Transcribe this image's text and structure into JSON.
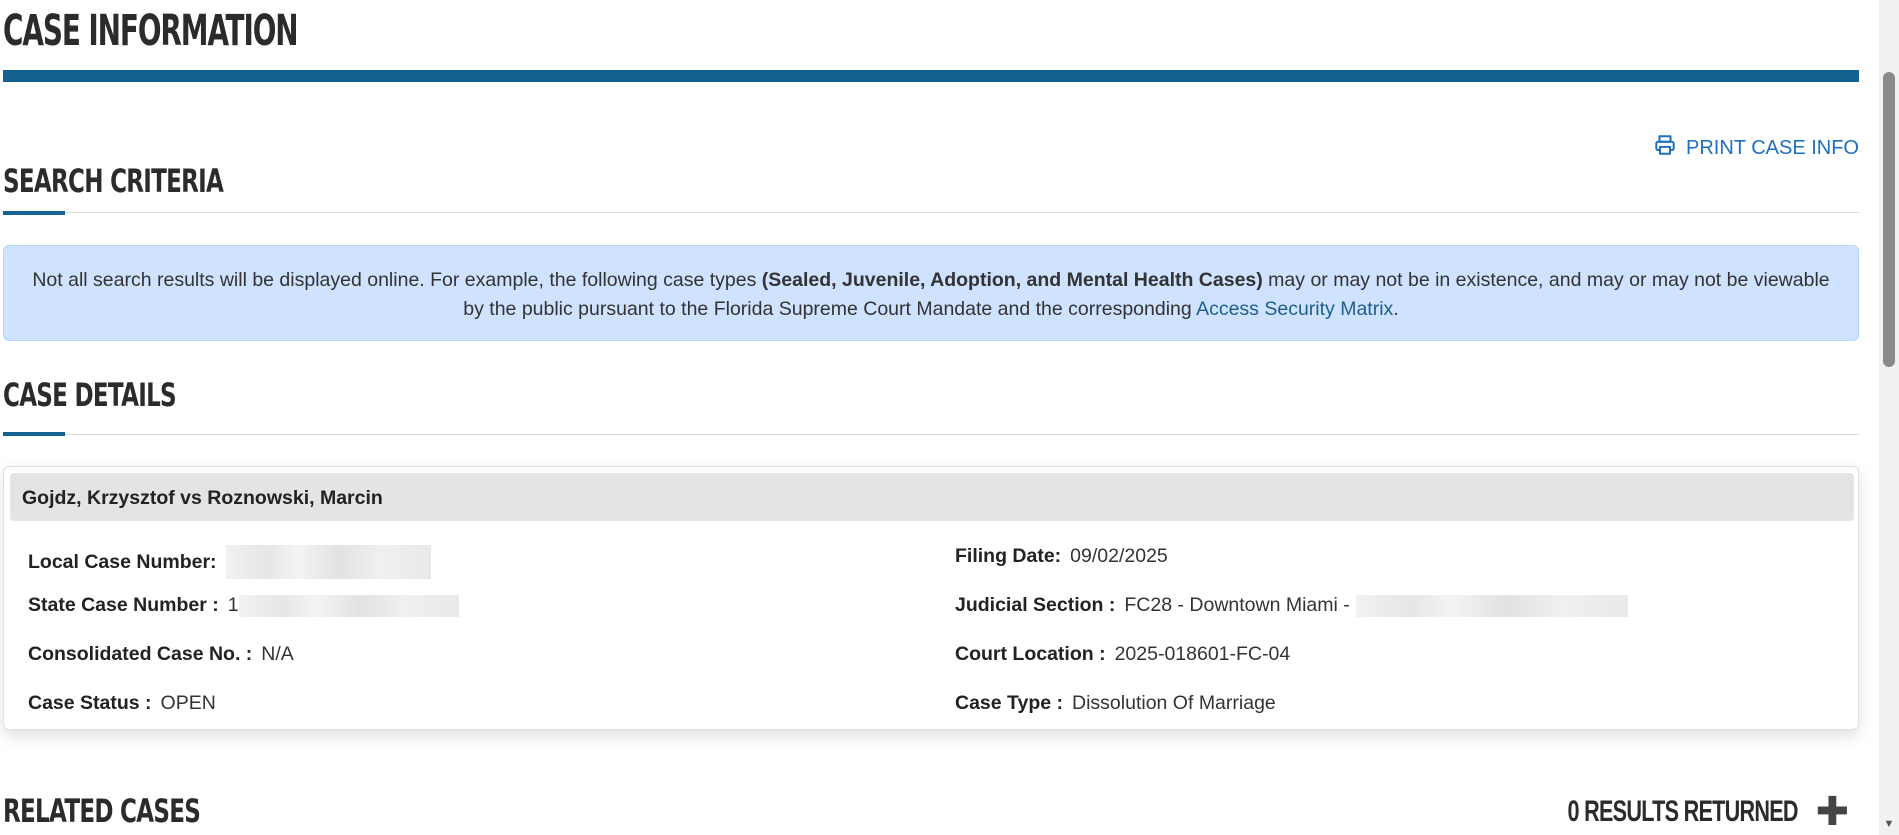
{
  "page": {
    "title": "CASE INFORMATION",
    "print_label": "PRINT CASE INFO",
    "print_icon": "printer-icon"
  },
  "search_criteria": {
    "title": "SEARCH CRITERIA",
    "notice_text_1": "Not all search results will be displayed online. For example, the following case types ",
    "notice_bold": "(Sealed, Juvenile, Adoption, and Mental Health Cases)",
    "notice_text_2": " may or may not be in existence, and may or may not be viewable by the public pursuant to the Florida Supreme Court Mandate and the corresponding ",
    "notice_link": "Access Security Matrix",
    "notice_end": "."
  },
  "case_details": {
    "title": "CASE DETAILS",
    "case_title": "Gojdz, Krzysztof vs Roznowski, Marcin",
    "local_case_number_label": "Local Case Number:",
    "state_case_number_label": "State Case Number :",
    "state_case_number_prefix": "1",
    "consolidated_label": "Consolidated Case No. :",
    "consolidated_value": "N/A",
    "status_label": "Case Status :",
    "status_value": "OPEN",
    "filing_date_label": "Filing Date:",
    "filing_date_value": "09/02/2025",
    "judicial_section_label": "Judicial Section :",
    "judicial_section_value": "FC28 - Downtown Miami -",
    "court_location_label": "Court Location :",
    "court_location_value": "2025-018601-FC-04",
    "case_type_label": "Case Type :",
    "case_type_value": "Dissolution Of Marriage"
  },
  "related_cases": {
    "title": "RELATED CASES",
    "results": "0 RESULTS RETURNED",
    "expand_icon": "plus-icon"
  },
  "colors": {
    "accent": "#14628f",
    "link": "#1f6fbf",
    "notice_bg": "#cfe2ff"
  }
}
